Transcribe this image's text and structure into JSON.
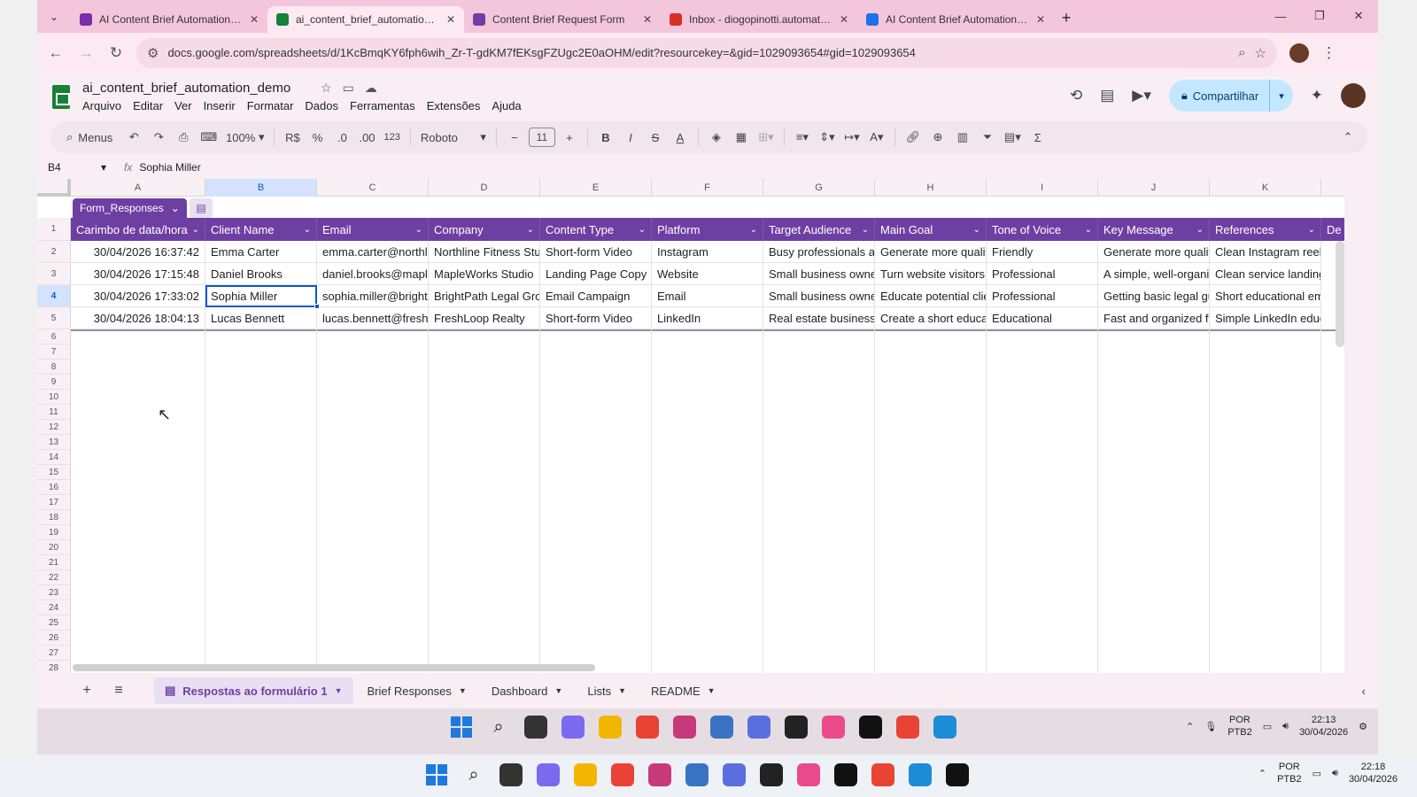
{
  "browser": {
    "tabs": [
      {
        "title": "AI Content Brief Automation | M",
        "icon": "make-icon",
        "color": "#7b2ea8",
        "active": false
      },
      {
        "title": "ai_content_brief_automation_d",
        "icon": "sheets-icon",
        "color": "#188038",
        "active": true
      },
      {
        "title": "Content Brief Request Form",
        "icon": "forms-icon",
        "color": "#6e3fa3",
        "active": false
      },
      {
        "title": "Inbox - diogopinotti.automation",
        "icon": "gmail-icon",
        "color": "#d93025",
        "active": false
      },
      {
        "title": "AI Content Brief Automation - G",
        "icon": "drive-icon",
        "color": "#1a73e8",
        "active": false
      }
    ],
    "url": "docs.google.com/spreadsheets/d/1KcBmqKY6fph6wih_Zr-T-gdKM7fEKsgFZUgc2E0aOHM/edit?resourcekey=&gid=1029093654#gid=1029093654"
  },
  "doc": {
    "title": "ai_content_brief_automation_demo",
    "menu": [
      "Arquivo",
      "Editar",
      "Ver",
      "Inserir",
      "Formatar",
      "Dados",
      "Ferramentas",
      "Extensões",
      "Ajuda"
    ],
    "share_label": "Compartilhar"
  },
  "toolbar": {
    "menus_label": "Menus",
    "zoom": "100%",
    "currency": "R$",
    "percent": "%",
    "dec_less": ".0",
    "dec_more": ".00",
    "number_format": "123",
    "font": "Roboto",
    "font_size": "11"
  },
  "formula": {
    "cell_ref": "B4",
    "value": "Sophia Miller"
  },
  "grid": {
    "columns": [
      "A",
      "B",
      "C",
      "D",
      "E",
      "F",
      "G",
      "H",
      "I",
      "J",
      "K"
    ],
    "selected_column": "B",
    "table_name": "Form_Responses",
    "headers": [
      "Carimbo de data/hora",
      "Client Name",
      "Email",
      "Company",
      "Content Type",
      "Platform",
      "Target Audience",
      "Main Goal",
      "Tone of Voice",
      "Key Message",
      "References",
      "De"
    ],
    "rows": [
      [
        "30/04/2026 16:37:42",
        "Emma Carter",
        "emma.carter@northli",
        "Northline Fitness Stu",
        "Short-form Video",
        "Instagram",
        "Busy professionals ag",
        "Generate more qualifi",
        "Friendly",
        "Generate more qualifi",
        "Clean Instagram reels"
      ],
      [
        "30/04/2026 17:15:48",
        "Daniel Brooks",
        "daniel.brooks@maple",
        "MapleWorks Studio",
        "Landing Page Copy",
        "Website",
        "Small business owne",
        "Turn website visitors",
        "Professional",
        "A simple, well-organiz",
        "Clean service landing"
      ],
      [
        "30/04/2026 17:33:02",
        "Sophia Miller",
        "sophia.miller@brightp",
        "BrightPath Legal Grou",
        "Email Campaign",
        "Email",
        "Small business owne",
        "Educate potential clie",
        "Professional",
        "Getting basic legal gu",
        "Short educational em"
      ],
      [
        "30/04/2026 18:04:13",
        "Lucas Bennett",
        "lucas.bennett@freshl",
        "FreshLoop Realty",
        "Short-form Video",
        "LinkedIn",
        "Real estate business",
        "Create a short educat",
        "Educational",
        "Fast and organized fo",
        "Simple LinkedIn educ"
      ]
    ],
    "row_numbers": [
      "1",
      "2",
      "3",
      "4",
      "5",
      "6",
      "7",
      "8",
      "9",
      "10",
      "11",
      "12",
      "13",
      "14",
      "15",
      "16",
      "17",
      "18",
      "19",
      "20",
      "21",
      "22",
      "23",
      "24",
      "25",
      "26",
      "27",
      "28"
    ],
    "selected_row": "4"
  },
  "sheets": {
    "tabs": [
      {
        "label": "Respostas ao formulário 1",
        "active": true
      },
      {
        "label": "Brief Responses",
        "active": false
      },
      {
        "label": "Dashboard",
        "active": false
      },
      {
        "label": "Lists",
        "active": false
      },
      {
        "label": "README",
        "active": false
      }
    ]
  },
  "taskbar_inner": {
    "lang": "POR",
    "layout": "PTB2",
    "time": "22:13",
    "date": "30/04/2026"
  },
  "taskbar_outer": {
    "lang": "POR",
    "layout": "PTB2",
    "time": "22:18",
    "date": "30/04/2026"
  }
}
